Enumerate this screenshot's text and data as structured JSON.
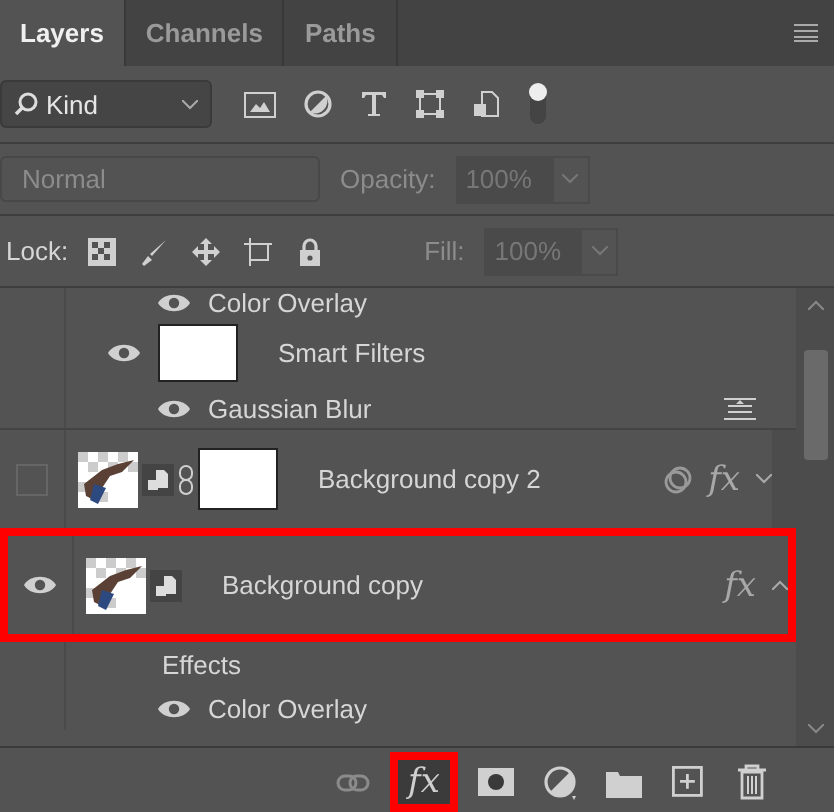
{
  "tabs": [
    {
      "label": "Layers",
      "selected": true
    },
    {
      "label": "Channels",
      "selected": false
    },
    {
      "label": "Paths",
      "selected": false
    }
  ],
  "filter": {
    "value": "Kind",
    "toggle_on": true
  },
  "blend": {
    "value": "Normal",
    "disabled": true,
    "opacity_label": "Opacity:",
    "opacity": "100%"
  },
  "lock": {
    "label": "Lock:",
    "fill_label": "Fill:",
    "fill": "100%"
  },
  "layers": [
    {
      "kind": "effect",
      "name": "Color Overlay",
      "visible": true
    },
    {
      "kind": "smart-filters",
      "name": "Smart Filters",
      "visible": true
    },
    {
      "kind": "filter",
      "name": "Gaussian Blur",
      "visible": true
    },
    {
      "kind": "layer",
      "name": "Background copy 2",
      "visible": false,
      "linked": true,
      "has_mask": true,
      "clipped": true,
      "fx": "fx",
      "expanded": false,
      "highlighted": false
    },
    {
      "kind": "layer",
      "name": "Background copy",
      "visible": true,
      "linked": false,
      "has_mask": false,
      "clipped": false,
      "fx": "fx",
      "expanded": true,
      "highlighted": true
    },
    {
      "kind": "effects-header",
      "name": "Effects"
    },
    {
      "kind": "effect",
      "name": "Color Overlay",
      "visible": true
    }
  ],
  "toolbar": [
    {
      "kind": "link",
      "disabled": true,
      "highlighted": false
    },
    {
      "kind": "fx",
      "label": "fx",
      "disabled": false,
      "highlighted": true
    },
    {
      "kind": "mask",
      "disabled": false,
      "highlighted": false
    },
    {
      "kind": "adjustment",
      "disabled": false,
      "highlighted": false
    },
    {
      "kind": "folder",
      "disabled": false,
      "highlighted": false
    },
    {
      "kind": "new",
      "disabled": false,
      "highlighted": false
    },
    {
      "kind": "delete",
      "disabled": false,
      "highlighted": false
    }
  ]
}
